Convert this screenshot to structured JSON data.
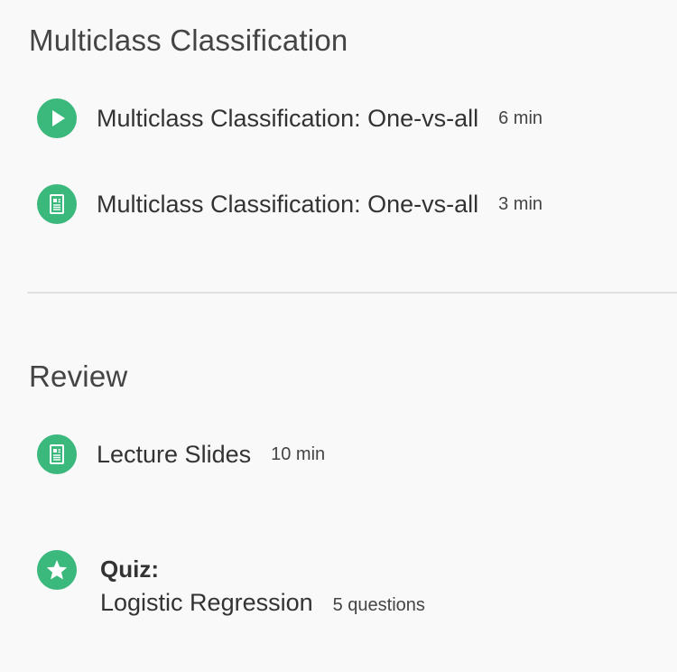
{
  "sections": [
    {
      "title": "Multiclass Classification",
      "items": [
        {
          "icon": "play-icon",
          "label": "Multiclass Classification: One-vs-all",
          "meta": "6 min"
        },
        {
          "icon": "reading-icon",
          "label": "Multiclass Classification: One-vs-all",
          "meta": "3 min"
        }
      ]
    },
    {
      "title": "Review",
      "items": [
        {
          "icon": "reading-icon",
          "label": "Lecture Slides",
          "meta": "10 min"
        }
      ],
      "quiz": {
        "icon": "star-icon",
        "kind": "Quiz:",
        "title": "Logistic Regression",
        "meta": "5 questions"
      }
    }
  ],
  "colors": {
    "accent": "#3bb87c",
    "background": "#f9f9f9",
    "divider": "#e2e2e2"
  }
}
